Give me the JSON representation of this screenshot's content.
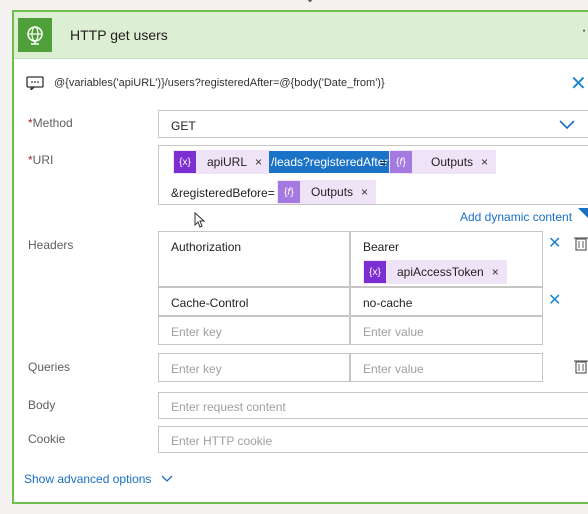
{
  "action": {
    "title": "HTTP get users",
    "summary": "@{variables('apiURL')}/users?registeredAfter=@{body('Date_from')}",
    "more_label": "··"
  },
  "method": {
    "label": "Method",
    "value": "GET"
  },
  "uri": {
    "label": "URI",
    "token_api_url": "apiURL",
    "selected_text": "/leads?registeredAfter",
    "after_selection": "=",
    "token_outputs_1": "Outputs",
    "line2_text": "&registeredBefore=",
    "token_outputs_2": "Outputs",
    "add_dynamic": "Add dynamic content",
    "var_icon": "{x}",
    "expr_icon": "{𝑓}"
  },
  "headers": {
    "label": "Headers",
    "rows": [
      {
        "key": "Authorization",
        "value_text": "Bearer",
        "value_token": "apiAccessToken"
      },
      {
        "key": "Cache-Control",
        "value_text": "no-cache"
      }
    ],
    "key_placeholder": "Enter key",
    "value_placeholder": "Enter value"
  },
  "queries": {
    "label": "Queries",
    "key_placeholder": "Enter key",
    "value_placeholder": "Enter value"
  },
  "body": {
    "label": "Body",
    "placeholder": "Enter request content"
  },
  "cookie": {
    "label": "Cookie",
    "placeholder": "Enter HTTP cookie"
  },
  "advanced": {
    "label": "Show advanced options"
  },
  "glyphs": {
    "close": "✕",
    "token_close": "×",
    "required": "*"
  },
  "colors": {
    "header_bg": "#dcefd2",
    "card_border": "#6ebf4a",
    "icon_bg": "#4f9f3a",
    "variable_token": "#7b2ed1",
    "expression_token": "#a57ae0",
    "link": "#1a6fc4",
    "selection": "#1a73c7"
  }
}
